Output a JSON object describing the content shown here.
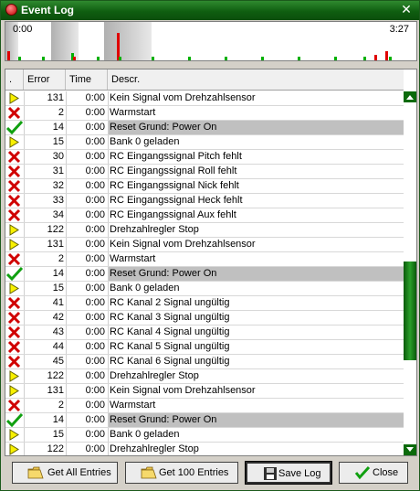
{
  "window": {
    "title": "Event Log"
  },
  "timeline": {
    "start": "0:00",
    "end": "3:27",
    "colors": {
      "error": "#e00000",
      "ok": "#00b000",
      "shade": "#b0b0b0"
    }
  },
  "table": {
    "columns": [
      ".",
      "Error",
      "Time",
      "Descr."
    ],
    "rows": [
      {
        "icon": "warning-arrow-icon",
        "error": "131",
        "time": "0:00",
        "descr": "Kein Signal vom Drehzahlsensor"
      },
      {
        "icon": "error-x-icon",
        "error": "2",
        "time": "0:00",
        "descr": "Warmstart"
      },
      {
        "icon": "checkmark-icon",
        "error": "14",
        "time": "0:00",
        "descr": "Reset Grund: Power On"
      },
      {
        "icon": "warning-arrow-icon",
        "error": "15",
        "time": "0:00",
        "descr": "Bank 0 geladen"
      },
      {
        "icon": "error-x-icon",
        "error": "30",
        "time": "0:00",
        "descr": "RC Eingangssignal Pitch fehlt"
      },
      {
        "icon": "error-x-icon",
        "error": "31",
        "time": "0:00",
        "descr": "RC Eingangssignal Roll fehlt"
      },
      {
        "icon": "error-x-icon",
        "error": "32",
        "time": "0:00",
        "descr": "RC Eingangssignal Nick fehlt"
      },
      {
        "icon": "error-x-icon",
        "error": "33",
        "time": "0:00",
        "descr": "RC Eingangssignal Heck fehlt"
      },
      {
        "icon": "error-x-icon",
        "error": "34",
        "time": "0:00",
        "descr": "RC Eingangssignal Aux fehlt"
      },
      {
        "icon": "warning-arrow-icon",
        "error": "122",
        "time": "0:00",
        "descr": "Drehzahlregler Stop"
      },
      {
        "icon": "warning-arrow-icon",
        "error": "131",
        "time": "0:00",
        "descr": "Kein Signal vom Drehzahlsensor"
      },
      {
        "icon": "error-x-icon",
        "error": "2",
        "time": "0:00",
        "descr": "Warmstart"
      },
      {
        "icon": "checkmark-icon",
        "error": "14",
        "time": "0:00",
        "descr": "Reset Grund: Power On"
      },
      {
        "icon": "warning-arrow-icon",
        "error": "15",
        "time": "0:00",
        "descr": "Bank 0 geladen"
      },
      {
        "icon": "error-x-icon",
        "error": "41",
        "time": "0:00",
        "descr": "RC Kanal 2 Signal ungültig"
      },
      {
        "icon": "error-x-icon",
        "error": "42",
        "time": "0:00",
        "descr": "RC Kanal 3 Signal ungültig"
      },
      {
        "icon": "error-x-icon",
        "error": "43",
        "time": "0:00",
        "descr": "RC Kanal 4 Signal ungültig"
      },
      {
        "icon": "error-x-icon",
        "error": "44",
        "time": "0:00",
        "descr": "RC Kanal 5 Signal ungültig"
      },
      {
        "icon": "error-x-icon",
        "error": "45",
        "time": "0:00",
        "descr": "RC Kanal 6 Signal ungültig"
      },
      {
        "icon": "warning-arrow-icon",
        "error": "122",
        "time": "0:00",
        "descr": "Drehzahlregler Stop"
      },
      {
        "icon": "warning-arrow-icon",
        "error": "131",
        "time": "0:00",
        "descr": "Kein Signal vom Drehzahlsensor"
      },
      {
        "icon": "error-x-icon",
        "error": "2",
        "time": "0:00",
        "descr": "Warmstart"
      },
      {
        "icon": "checkmark-icon",
        "error": "14",
        "time": "0:00",
        "descr": "Reset Grund: Power On"
      },
      {
        "icon": "warning-arrow-icon",
        "error": "15",
        "time": "0:00",
        "descr": "Bank 0 geladen"
      },
      {
        "icon": "warning-arrow-icon",
        "error": "122",
        "time": "0:00",
        "descr": "Drehzahlregler Stop"
      }
    ]
  },
  "buttons": {
    "get_all": "Get All Entries",
    "get_100": "Get 100 Entries",
    "save_log": "Save Log",
    "close": "Close"
  }
}
